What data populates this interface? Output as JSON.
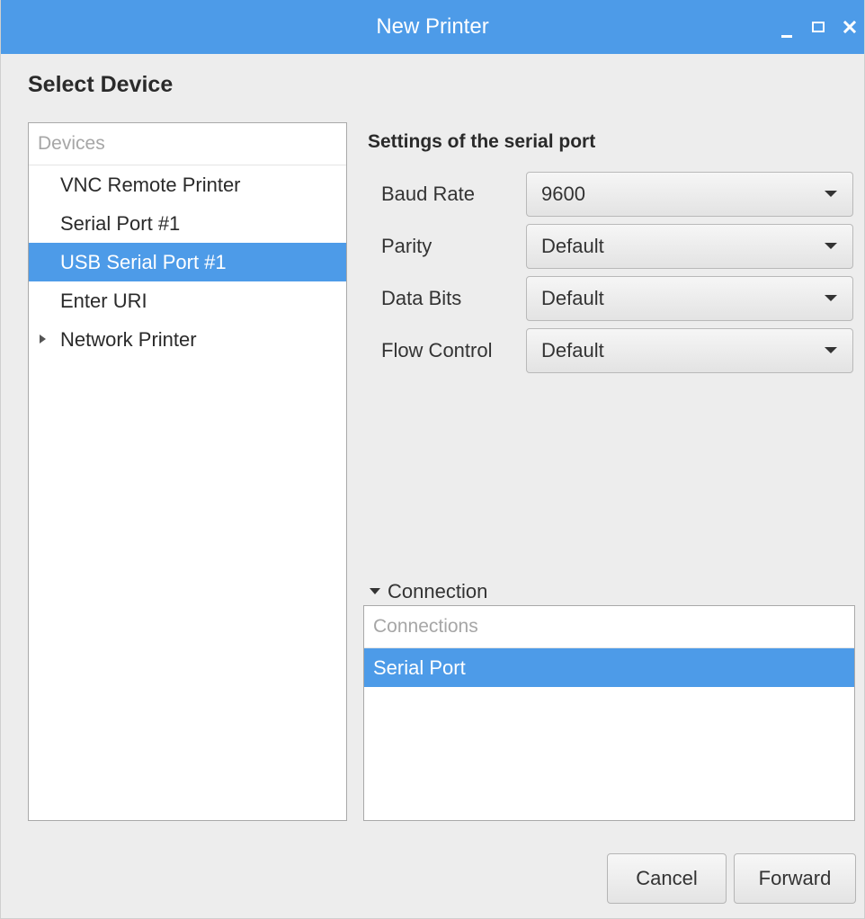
{
  "window": {
    "title": "New Printer"
  },
  "page": {
    "heading": "Select Device"
  },
  "devices": {
    "header": "Devices",
    "items": [
      {
        "label": "VNC Remote Printer",
        "selected": false,
        "expandable": false
      },
      {
        "label": "Serial Port #1",
        "selected": false,
        "expandable": false
      },
      {
        "label": "USB Serial Port #1",
        "selected": true,
        "expandable": false
      },
      {
        "label": "Enter URI",
        "selected": false,
        "expandable": false
      },
      {
        "label": "Network Printer",
        "selected": false,
        "expandable": true
      }
    ]
  },
  "settings": {
    "title": "Settings of the serial port",
    "fields": [
      {
        "label": "Baud Rate",
        "value": "9600"
      },
      {
        "label": "Parity",
        "value": "Default"
      },
      {
        "label": "Data Bits",
        "value": "Default"
      },
      {
        "label": "Flow Control",
        "value": "Default"
      }
    ]
  },
  "connection": {
    "expander_label": "Connection",
    "expanded": true,
    "header": "Connections",
    "items": [
      {
        "label": "Serial Port",
        "selected": true
      }
    ]
  },
  "buttons": {
    "cancel": "Cancel",
    "forward": "Forward"
  },
  "colors": {
    "accent": "#4d9be8",
    "background": "#ededed"
  },
  "icons": {
    "minimize": "minimize-icon",
    "maximize": "maximize-icon",
    "close": "close-icon",
    "expander": "triangle-right-icon",
    "dropdown": "chevron-down-icon"
  }
}
